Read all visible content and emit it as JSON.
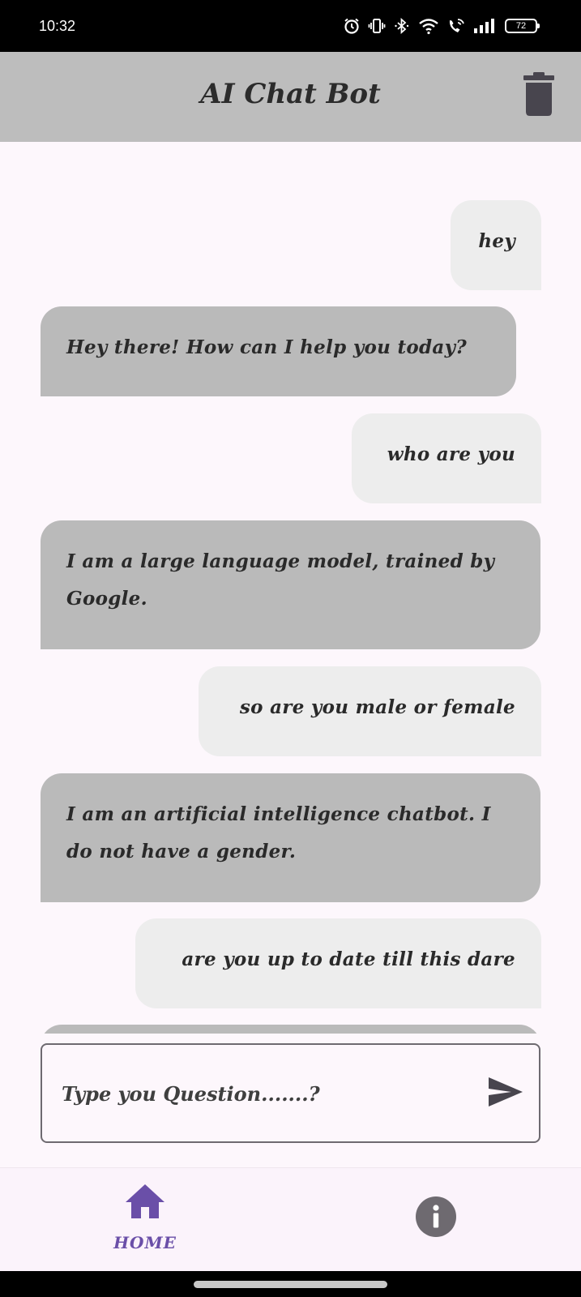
{
  "status_bar": {
    "time": "10:32",
    "battery": "72",
    "icons": [
      "alarm-icon",
      "vibrate-icon",
      "bluetooth-icon",
      "wifi-icon",
      "wifi-calling-icon",
      "signal-icon",
      "battery-icon"
    ]
  },
  "app_bar": {
    "title": "AI Chat Bot",
    "action_icon": "trash-icon"
  },
  "messages": [
    {
      "role": "user",
      "text": "hey"
    },
    {
      "role": "bot",
      "text": "Hey there! How can I help you today?"
    },
    {
      "role": "user",
      "text": "who are you"
    },
    {
      "role": "bot",
      "text": "I am a large language model, trained by Google."
    },
    {
      "role": "user",
      "text": "so are you male or female"
    },
    {
      "role": "bot",
      "text": "I am an artificial intelligence chatbot. I do not have a gender."
    },
    {
      "role": "user",
      "text": "are you up to date till this dare"
    },
    {
      "role": "bot",
      "text": ""
    }
  ],
  "input": {
    "placeholder": "Type you Question.......?",
    "value": "",
    "send_icon": "send-icon"
  },
  "bottom_nav": {
    "items": [
      {
        "label": "HOME",
        "icon": "home-icon",
        "active": true
      },
      {
        "label": "",
        "icon": "info-icon",
        "active": false
      }
    ]
  },
  "colors": {
    "app_bar": "#bdbdbd",
    "user_bubble": "#ededed",
    "bot_bubble": "#bababa",
    "background": "#fdf7fc",
    "nav_active": "#6a4fa8",
    "icon_dark": "#48454e"
  }
}
